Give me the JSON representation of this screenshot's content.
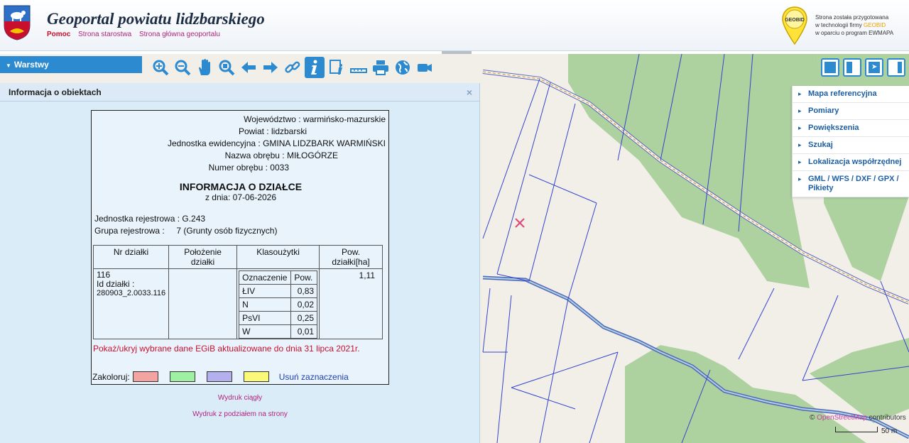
{
  "header": {
    "title": "Geoportal powiatu lidzbarskiego",
    "links": [
      "Pomoc",
      "Strona starostwa",
      "Strona główna geoportalu"
    ],
    "geobid_logo": "GEOBID",
    "credit_line1": "Strona została przygotowana",
    "credit_line2_prefix": "w technologii firmy",
    "credit_line2_brand": "GEOBID",
    "credit_line3": "w oparciu o program EWMAPA"
  },
  "layers": {
    "label": "Warstwy"
  },
  "toolbar": {
    "tools": [
      "zoom-in-icon",
      "zoom-out-icon",
      "pan-hand-icon",
      "zoom-box-icon",
      "arrow-left-icon",
      "arrow-right-icon",
      "link-icon",
      "info-icon",
      "legend-info-icon",
      "measure-ruler-icon",
      "print-icon",
      "globe-icon",
      "camera-icon"
    ],
    "active_tool": "info-icon"
  },
  "info_panel": {
    "title": "Informacja o obiektach",
    "close": "×",
    "header_fields": [
      {
        "label": "Województwo",
        "value": "warmińsko-mazurskie"
      },
      {
        "label": "Powiat",
        "value": "lidzbarski"
      },
      {
        "label": "Jednostka ewidencyjna",
        "value": "GMINA LIDZBARK WARMIŃSKI"
      },
      {
        "label": "Nazwa obrębu",
        "value": "MIŁOGÓRZE"
      },
      {
        "label": "Numer obrębu",
        "value": "0033"
      }
    ],
    "heading": "INFORMACJA O DZIAŁCE",
    "date": "z dnia: 07-06-2026",
    "registry_unit": "Jednostka rejestrowa : G.243",
    "registry_group_label": "Grupa rejestrowa :",
    "registry_group_value": "7 (Grunty osób fizycznych)",
    "table": {
      "headers": [
        "Nr działki",
        "Położenie działki",
        "Klasoużytki",
        "Pow. działki[ha]"
      ],
      "parcel_number": "116",
      "parcel_id_label": "Id działki :",
      "parcel_id": "280903_2.0033.116",
      "location": "",
      "area": "1,11",
      "class_headers": [
        "Oznaczenie",
        "Pow."
      ],
      "classes": [
        {
          "symbol": "ŁIV",
          "area": "0,83"
        },
        {
          "symbol": "N",
          "area": "0,02"
        },
        {
          "symbol": "PsVI",
          "area": "0,25"
        },
        {
          "symbol": "W",
          "area": "0,01"
        }
      ]
    },
    "toggle_link": "Pokaż/ukryj wybrane dane EGiB aktualizowane do dnia 31 lipca 2021r.",
    "colorize_label": "Zakoloruj:",
    "colors": [
      "#f4a3a3",
      "#9ff0a3",
      "#b4b0ee",
      "#fafa78"
    ],
    "clear_selection": "Usuń zaznaczenia",
    "print_continuous": "Wydruk ciągły",
    "print_paged": "Wydruk z podziałem na strony"
  },
  "side_menu": [
    "Mapa referencyjna",
    "Pomiary",
    "Powiększenia",
    "Szukaj",
    "Lokalizacja współrzędnej",
    "GML / WFS / DXF / GPX / Pikiety"
  ],
  "map": {
    "attribution_symbol": "©",
    "attribution_link": "OpenStreetMap",
    "attribution_suffix": "contributors",
    "scale_label": "50 m",
    "colors": {
      "land": "#f2efe9",
      "forest": "#aed1a0",
      "parcel_line": "#3344cc",
      "road_outline": "#5566bb",
      "marker": "#e0457b"
    }
  }
}
